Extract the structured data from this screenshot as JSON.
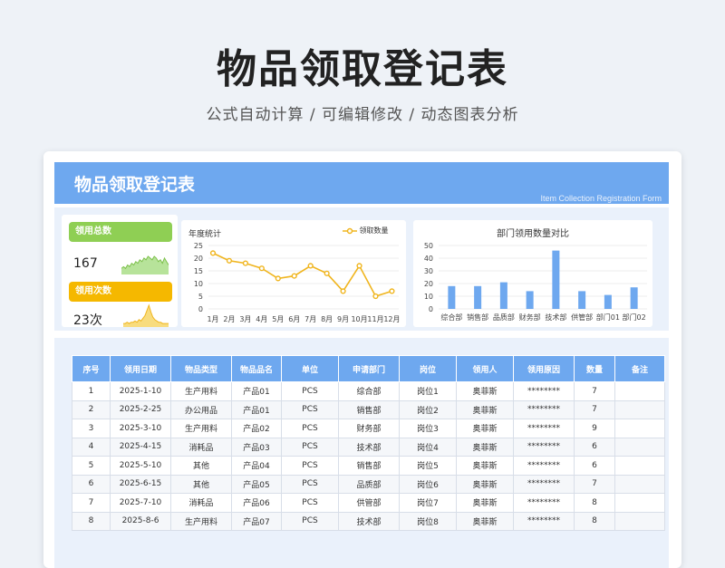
{
  "hero": {
    "title": "物品领取登记表",
    "subtitle": "公式自动计算 /  可编辑修改  / 动态图表分析"
  },
  "banner": {
    "title": "物品领取登记表",
    "subtitle_en": "Item Collection Registration Form"
  },
  "kpis": [
    {
      "label": "领用总数",
      "value": "167",
      "color": "#8fcf54"
    },
    {
      "label": "领用次数",
      "value": "23次",
      "color": "#f5b800"
    }
  ],
  "line_chart": {
    "title": "年度统计",
    "legend": "领取数量",
    "color": "#f0b51e"
  },
  "bar_chart": {
    "title": "部门领用数量对比",
    "color": "#6ea8ef"
  },
  "chart_data": [
    {
      "type": "line",
      "title": "年度统计",
      "categories": [
        "1月",
        "2月",
        "3月",
        "4月",
        "5月",
        "6月",
        "7月",
        "8月",
        "9月",
        "10月",
        "11月",
        "12月"
      ],
      "series": [
        {
          "name": "领取数量",
          "values": [
            22,
            19,
            18,
            16,
            12,
            13,
            17,
            14,
            7,
            17,
            5,
            7
          ]
        }
      ],
      "ylim": [
        0,
        25
      ],
      "yticks": [
        0,
        5,
        10,
        15,
        20,
        25
      ],
      "grid": true,
      "legend": "top-right"
    },
    {
      "type": "bar",
      "title": "部门领用数量对比",
      "categories": [
        "综合部",
        "销售部",
        "品质部",
        "财务部",
        "技术部",
        "供管部",
        "部门01",
        "部门02"
      ],
      "values": [
        18,
        18,
        21,
        14,
        46,
        14,
        11,
        17
      ],
      "ylim": [
        0,
        50
      ],
      "yticks": [
        0,
        10,
        20,
        30,
        40,
        50
      ],
      "grid": true
    }
  ],
  "mini_sparks": {
    "green": [
      3,
      4,
      3,
      5,
      4,
      6,
      5,
      7,
      6,
      8,
      7,
      9,
      8,
      10,
      9,
      8,
      10,
      9,
      7,
      8,
      6,
      9,
      7,
      5
    ],
    "yellow": [
      2,
      2,
      3,
      2,
      3,
      3,
      4,
      3,
      5,
      4,
      6,
      8,
      12,
      16,
      11,
      7,
      5,
      4,
      3,
      3,
      2,
      2,
      2,
      2
    ]
  },
  "table": {
    "headers": [
      "序号",
      "领用日期",
      "物品类型",
      "物品品名",
      "单位",
      "申请部门",
      "岗位",
      "领用人",
      "领用原因",
      "数量",
      "备注"
    ],
    "rows": [
      [
        "1",
        "2025-1-10",
        "生产用料",
        "产品01",
        "PCS",
        "综合部",
        "岗位1",
        "奥菲斯",
        "********",
        "7",
        ""
      ],
      [
        "2",
        "2025-2-25",
        "办公用品",
        "产品01",
        "PCS",
        "销售部",
        "岗位2",
        "奥菲斯",
        "********",
        "7",
        ""
      ],
      [
        "3",
        "2025-3-10",
        "生产用料",
        "产品02",
        "PCS",
        "财务部",
        "岗位3",
        "奥菲斯",
        "********",
        "9",
        ""
      ],
      [
        "4",
        "2025-4-15",
        "消耗品",
        "产品03",
        "PCS",
        "技术部",
        "岗位4",
        "奥菲斯",
        "********",
        "6",
        ""
      ],
      [
        "5",
        "2025-5-10",
        "其他",
        "产品04",
        "PCS",
        "销售部",
        "岗位5",
        "奥菲斯",
        "********",
        "6",
        ""
      ],
      [
        "6",
        "2025-6-15",
        "其他",
        "产品05",
        "PCS",
        "品质部",
        "岗位6",
        "奥菲斯",
        "********",
        "7",
        ""
      ],
      [
        "7",
        "2025-7-10",
        "消耗品",
        "产品06",
        "PCS",
        "供管部",
        "岗位7",
        "奥菲斯",
        "********",
        "8",
        ""
      ],
      [
        "8",
        "2025-8-6",
        "生产用料",
        "产品07",
        "PCS",
        "技术部",
        "岗位8",
        "奥菲斯",
        "********",
        "8",
        ""
      ]
    ]
  }
}
